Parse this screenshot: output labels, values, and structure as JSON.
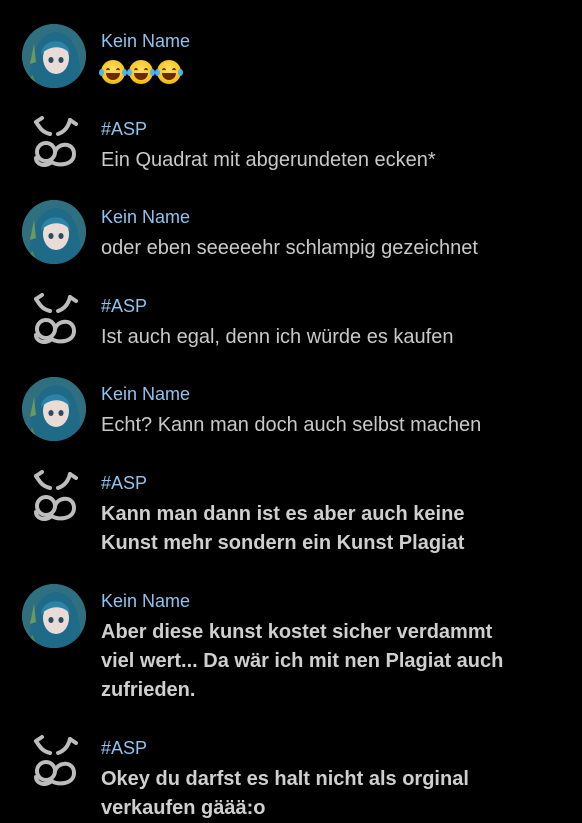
{
  "messages": [
    {
      "sender": "Kein Name",
      "avatar": "anime-girl-avatar",
      "text": "",
      "emoji": [
        "face-with-tears-of-joy",
        "face-with-tears-of-joy",
        "face-with-tears-of-joy"
      ]
    },
    {
      "sender": "#ASP",
      "avatar": "asp-logo-avatar",
      "text": "Ein Quadrat mit abgerundeten ecken*"
    },
    {
      "sender": "Kein Name",
      "avatar": "anime-girl-avatar",
      "text": "oder eben seeeeehr schlampig gezeichnet"
    },
    {
      "sender": "#ASP",
      "avatar": "asp-logo-avatar",
      "text": "Ist auch egal, denn ich würde es kaufen"
    },
    {
      "sender": "Kein Name",
      "avatar": "anime-girl-avatar",
      "text": "Echt? Kann man doch auch selbst machen"
    },
    {
      "sender": "#ASP",
      "avatar": "asp-logo-avatar",
      "lines": [
        "Kann man dann ist es aber auch keine",
        "Kunst mehr sondern ein Kunst Plagiat"
      ]
    },
    {
      "sender": "Kein Name",
      "avatar": "anime-girl-avatar",
      "lines": [
        "Aber diese kunst kostet sicher verdammt",
        "viel wert... Da wär ich mit nen Plagiat auch",
        "zufrieden."
      ]
    },
    {
      "sender": "#ASP",
      "avatar": "asp-logo-avatar",
      "lines": [
        "Okey du darfst es halt nicht als orginal",
        "verkaufen gäää:o"
      ]
    }
  ],
  "colors": {
    "background": "#000000",
    "sender_name": "#8fc4ee",
    "message_text": "#c9c9c9"
  }
}
